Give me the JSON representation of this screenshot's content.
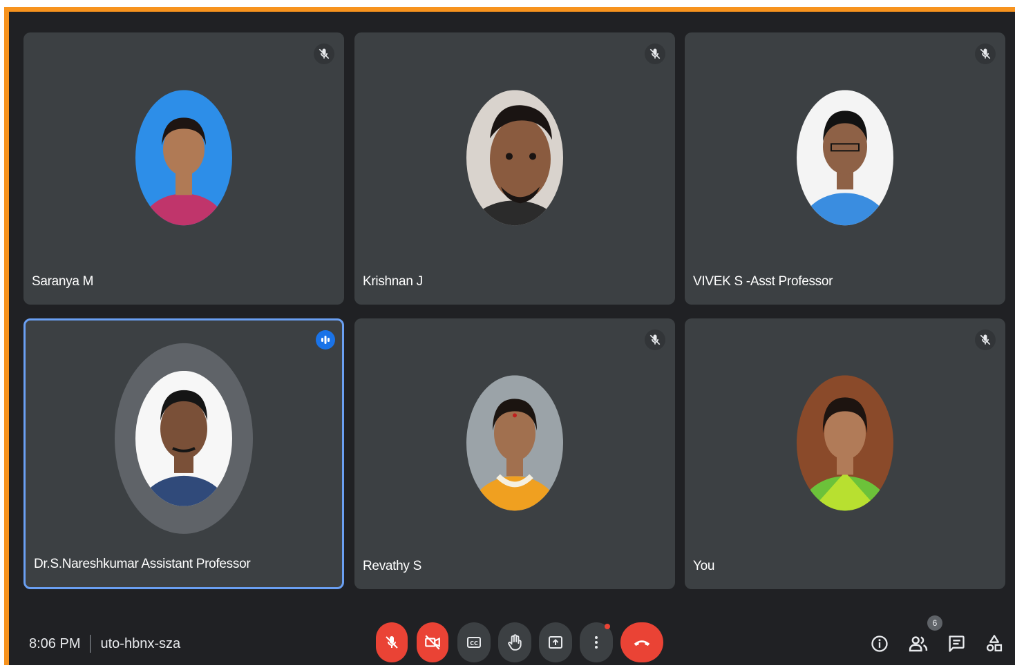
{
  "participants": [
    {
      "name": "Saranya M",
      "muted": true,
      "bg": "#2d8ee8",
      "skin": "#b07a55",
      "hair": "#1e1512",
      "cloth": "#c0356b"
    },
    {
      "name": "Krishnan J",
      "muted": true,
      "bg": "#d9d3cd",
      "skin": "#8a5b3f",
      "hair": "#1a1412",
      "cloth": "#2b2b2b"
    },
    {
      "name": "VIVEK S -Asst Professor",
      "muted": true,
      "bg": "#f4f4f4",
      "skin": "#8e6146",
      "hair": "#121212",
      "cloth": "#3a8de0"
    },
    {
      "name": "Dr.S.Nareshkumar Assistant Professor",
      "muted": false,
      "speaking": true,
      "bg": "#f7f7f7",
      "skin": "#7a5038",
      "hair": "#151515",
      "cloth": "#304a7a"
    },
    {
      "name": "Revathy S",
      "muted": true,
      "bg": "#9ba3a8",
      "skin": "#a1704f",
      "hair": "#1b1410",
      "cloth": "#f0a020"
    },
    {
      "name": "You",
      "muted": true,
      "bg": "#8a4a2a",
      "skin": "#b17b58",
      "hair": "#1d1410",
      "cloth": "#6cc23a"
    }
  ],
  "bottom_bar": {
    "time": "8:06 PM",
    "meeting_code": "uto-hbnx-sza",
    "participant_count": "6"
  },
  "colors": {
    "frame_border": "#f7931e",
    "tile_bg": "#3c4043",
    "active_border": "#6a9ff2",
    "danger": "#ea4335"
  }
}
